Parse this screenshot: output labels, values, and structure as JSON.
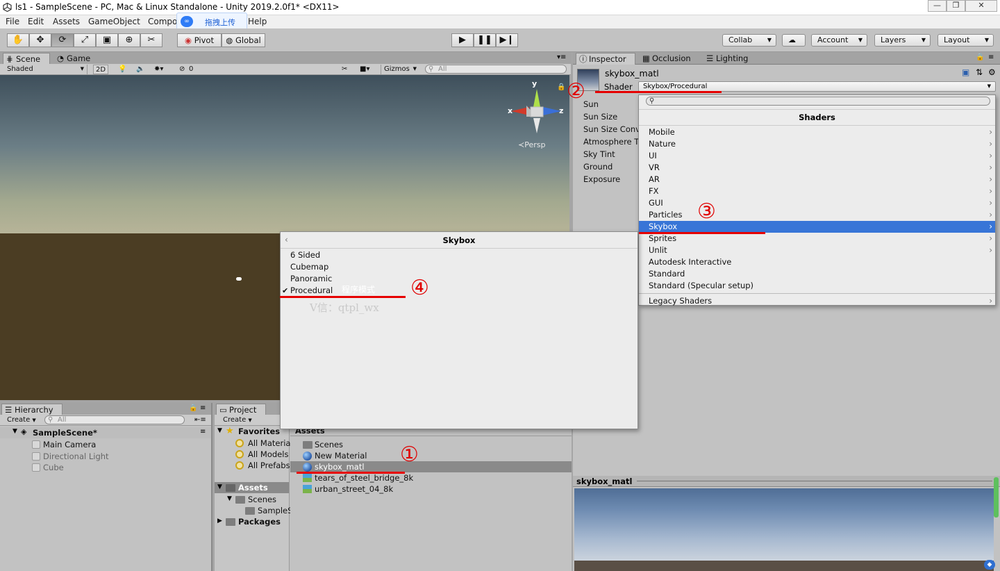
{
  "window": {
    "title": "ls1 - SampleScene - PC, Mac & Linux Standalone - Unity 2019.2.0f1* <DX11>",
    "min_glyph": "—",
    "max_glyph": "❐",
    "close_glyph": "✕"
  },
  "menu": [
    "File",
    "Edit",
    "Assets",
    "GameObject",
    "Compo",
    "Help"
  ],
  "baidu_button": {
    "label": "拖拽上传"
  },
  "toolbar": {
    "tools": [
      "hand-tool",
      "move-tool",
      "rotate-tool",
      "scale-tool",
      "rect-tool",
      "transform-tool",
      "custom-tool"
    ],
    "pivot_label": "Pivot",
    "global_label": "Global",
    "collab_label": "Collab",
    "account_label": "Account",
    "layers_label": "Layers",
    "layout_label": "Layout"
  },
  "scene": {
    "tabs": [
      "Scene",
      "Game"
    ],
    "shading_mode": "Shaded",
    "mode_2d": "2D",
    "hidden_count": "0",
    "gizmos_label": "Gizmos",
    "search_placeholder": "All",
    "persp_label": "Persp",
    "axis_x": "x",
    "axis_y": "y",
    "axis_z": "z"
  },
  "inspector": {
    "tabs": [
      "Inspector",
      "Occlusion",
      "Lighting"
    ],
    "material_name": "skybox_matl",
    "shader_label": "Shader",
    "shader_value": "Skybox/Procedural",
    "properties": [
      "Sun",
      "Sun Size",
      "Sun Size Conv",
      "Atmosphere T",
      "Sky Tint",
      "Ground",
      "Exposure"
    ]
  },
  "shader_menu": {
    "header": "Shaders",
    "items": [
      {
        "label": "Mobile",
        "submenu": true
      },
      {
        "label": "Nature",
        "submenu": true
      },
      {
        "label": "UI",
        "submenu": true
      },
      {
        "label": "VR",
        "submenu": true
      },
      {
        "label": "AR",
        "submenu": true
      },
      {
        "label": "FX",
        "submenu": true
      },
      {
        "label": "GUI",
        "submenu": true
      },
      {
        "label": "Particles",
        "submenu": true
      },
      {
        "label": "Skybox",
        "submenu": true,
        "highlighted": true
      },
      {
        "label": "Sprites",
        "submenu": true
      },
      {
        "label": "Unlit",
        "submenu": true
      },
      {
        "label": "Autodesk Interactive",
        "submenu": false
      },
      {
        "label": "Standard",
        "submenu": false
      },
      {
        "label": "Standard (Specular setup)",
        "submenu": false
      },
      {
        "label": "Legacy Shaders",
        "submenu": true
      }
    ]
  },
  "skybox_menu": {
    "header": "Skybox",
    "items": [
      {
        "label": "6 Sided",
        "checked": false
      },
      {
        "label": "Cubemap",
        "checked": false
      },
      {
        "label": "Panoramic",
        "checked": false
      },
      {
        "label": "Procedural",
        "checked": true
      }
    ],
    "check_glyph": "✔",
    "procedural_note": "程序模式",
    "watermark": "V信：qtpl_wx"
  },
  "hierarchy": {
    "tab": "Hierarchy",
    "create_label": "Create",
    "search_placeholder": "All",
    "scene_name": "SampleScene*",
    "objects": [
      "Main Camera",
      "Directional Light",
      "Cube"
    ]
  },
  "project": {
    "tab": "Project",
    "create_label": "Create",
    "favorites_label": "Favorites",
    "favorites": [
      "All Materia",
      "All Models",
      "All Prefabs"
    ],
    "assets_label": "Assets",
    "tree_scenes": "Scenes",
    "tree_sample": "SampleS",
    "packages_label": "Packages",
    "content_header": "Assets",
    "content_items": [
      {
        "label": "Scenes",
        "kind": "folder"
      },
      {
        "label": "New Material",
        "kind": "material"
      },
      {
        "label": "skybox_matl",
        "kind": "material",
        "selected": true
      },
      {
        "label": "tears_of_steel_bridge_8k",
        "kind": "texture"
      },
      {
        "label": "urban_street_04_8k",
        "kind": "texture"
      }
    ]
  },
  "preview": {
    "title": "skybox_matl"
  },
  "annotations": {
    "n1": "①",
    "n2": "②",
    "n3": "③",
    "n4": "④"
  },
  "colors": {
    "highlight": "#3875d7",
    "annotation_red": "#e60000",
    "selected_row": "#8a8a8a"
  }
}
